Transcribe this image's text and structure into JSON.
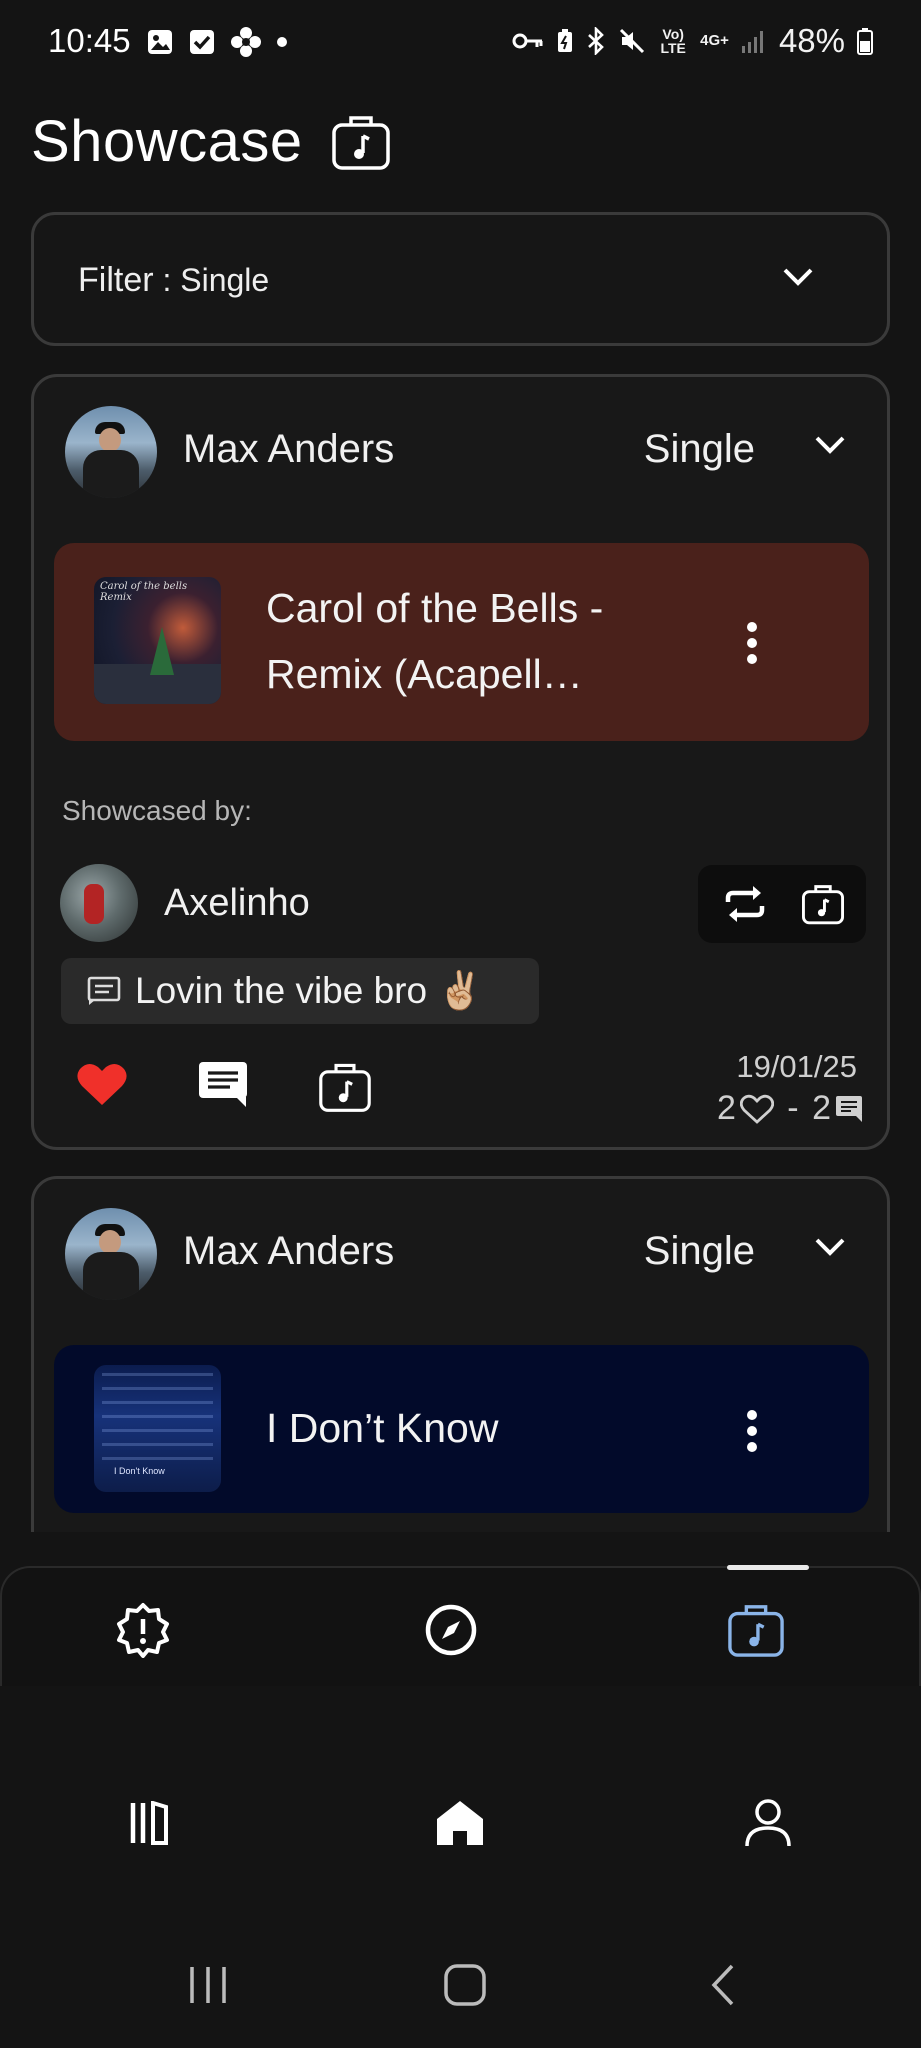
{
  "status_bar": {
    "time": "10:45",
    "network": "Vo) LTE",
    "network_type": "4G+",
    "battery": "48%"
  },
  "header": {
    "title": "Showcase"
  },
  "filter": {
    "label": "Filter",
    "separator": " : ",
    "value": "Single"
  },
  "posts": [
    {
      "author": "Max Anders",
      "type": "Single",
      "track": {
        "title": "Carol of the Bells - Remix (Acapell…",
        "cover_caption": "Carol of the bells Remix",
        "card_color": "#4a211b"
      },
      "showcased_label": "Showcased by:",
      "showcaser": "Axelinho",
      "comment": "Lovin the vibe bro ✌🏼",
      "date": "19/01/25",
      "likes": "2",
      "stats_separator": " - ",
      "comments": "2",
      "liked": true
    },
    {
      "author": "Max Anders",
      "type": "Single",
      "track": {
        "title": "I Don’t Know",
        "cover_caption": "I Don't Know",
        "card_color": "#020a2a"
      }
    }
  ],
  "tabs": [
    {
      "icon": "alert-badge-icon",
      "active": false
    },
    {
      "icon": "compass-icon",
      "active": false
    },
    {
      "icon": "music-briefcase-icon",
      "active": true
    }
  ],
  "app_nav": [
    "library-icon",
    "home-icon",
    "profile-icon"
  ],
  "colors": {
    "background": "#141414",
    "accent_active_tab": "#8ab4e8",
    "like": "#f0302a"
  }
}
